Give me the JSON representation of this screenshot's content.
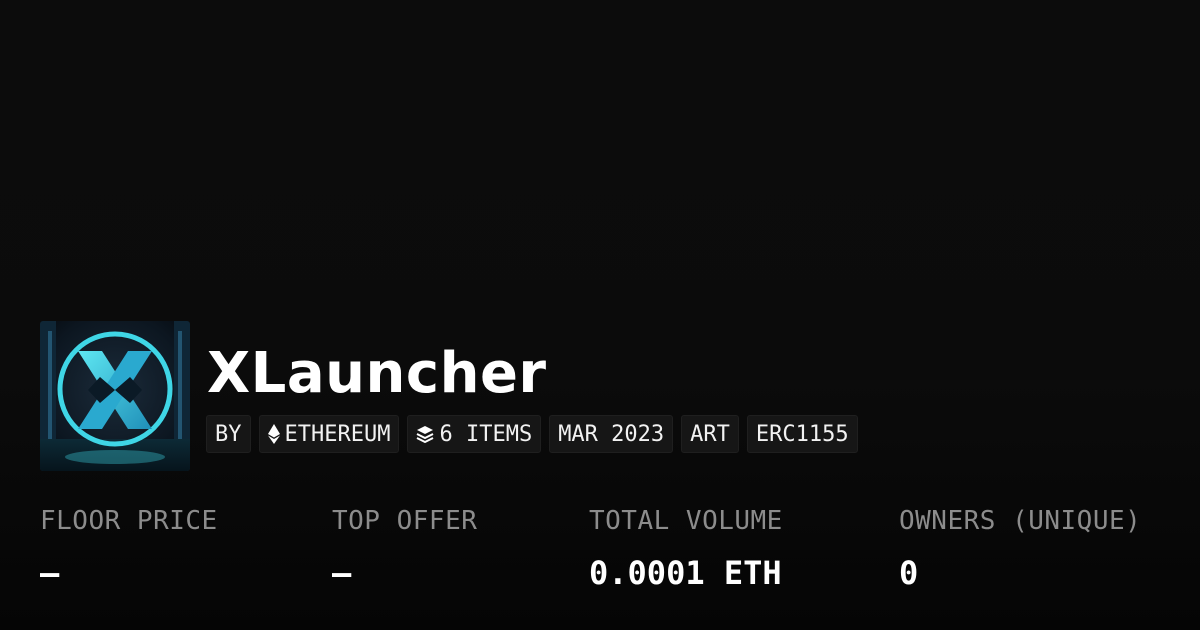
{
  "collection": {
    "name": "XLauncher",
    "logo_icon": "xlauncher-logo-icon",
    "tags": [
      {
        "label": "BY",
        "icon": null
      },
      {
        "label": "ETHEREUM",
        "icon": "ethereum-icon"
      },
      {
        "label": "6 ITEMS",
        "icon": "layers-icon"
      },
      {
        "label": "MAR 2023",
        "icon": null
      },
      {
        "label": "ART",
        "icon": null
      },
      {
        "label": "ERC1155",
        "icon": null
      }
    ]
  },
  "stats": [
    {
      "label": "FLOOR PRICE",
      "value": "–"
    },
    {
      "label": "TOP OFFER",
      "value": "–"
    },
    {
      "label": "TOTAL VOLUME",
      "value": "0.0001 ETH"
    },
    {
      "label": "OWNERS (UNIQUE)",
      "value": "0"
    }
  ],
  "colors": {
    "background": "#0b0b0b",
    "tag_background": "#161616",
    "label_gray": "#8c8c8c",
    "logo_accent": "#3fd6e6"
  }
}
